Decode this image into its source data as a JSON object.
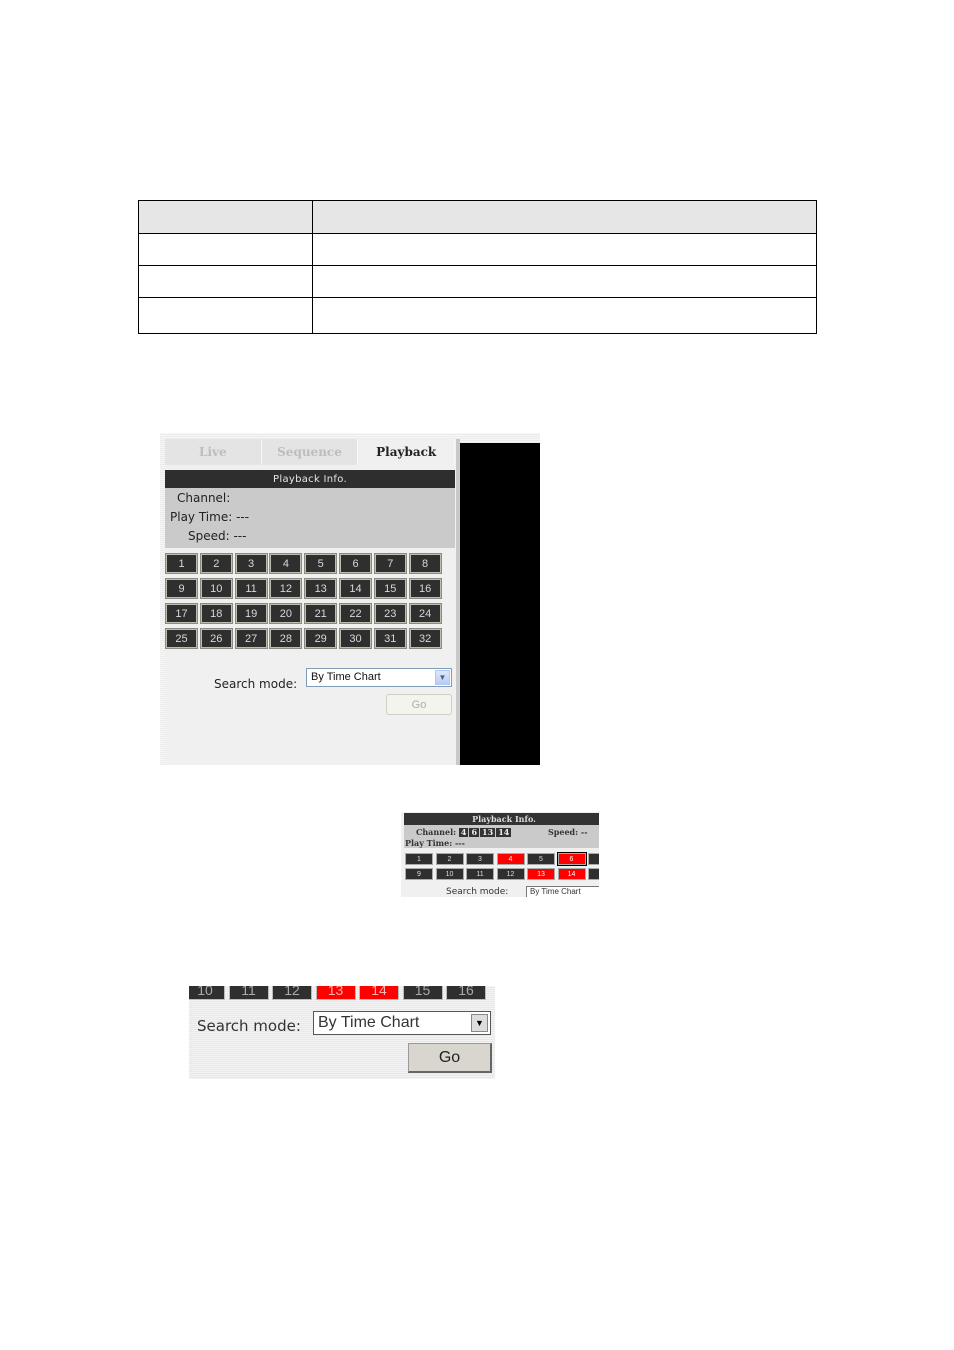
{
  "table": {
    "rows": [
      [
        "",
        ""
      ],
      [
        "",
        ""
      ],
      [
        "",
        ""
      ],
      [
        "",
        ""
      ]
    ]
  },
  "panel": {
    "tabs": [
      {
        "label": "Live",
        "active": false
      },
      {
        "label": "Sequence",
        "active": false
      },
      {
        "label": "Playback",
        "active": true
      }
    ],
    "info_title": "Playback Info.",
    "channel_label": "Channel:",
    "play_time_label": "Play Time: ---",
    "speed_label": "Speed: ---",
    "channels": [
      "1",
      "2",
      "3",
      "4",
      "5",
      "6",
      "7",
      "8",
      "9",
      "10",
      "11",
      "12",
      "13",
      "14",
      "15",
      "16",
      "17",
      "18",
      "19",
      "20",
      "21",
      "22",
      "23",
      "24",
      "25",
      "26",
      "27",
      "28",
      "29",
      "30",
      "31",
      "32"
    ],
    "search_mode_label": "Search mode:",
    "search_mode_value": "By Time Chart",
    "go_label": "Go"
  },
  "example_selected": {
    "info_title": "Playback Info.",
    "channel_label": "Channel:",
    "selected_channels": [
      "4",
      "6",
      "13",
      "14"
    ],
    "speed_label": "Speed: --",
    "play_time_label": "Play Time: ---",
    "row1": [
      "1",
      "2",
      "3",
      "4",
      "5",
      "6"
    ],
    "row2": [
      "9",
      "10",
      "11",
      "12",
      "13",
      "14"
    ],
    "red_channels": [
      "4",
      "6",
      "13",
      "14"
    ],
    "search_mode_label": "Search mode:",
    "search_mode_value": "By Time Chart",
    "highlight_color": "#ff0000"
  },
  "example_go": {
    "channels": [
      "10",
      "11",
      "12",
      "13",
      "14",
      "15",
      "16"
    ],
    "red_channels": [
      "13",
      "14"
    ],
    "search_mode_label": "Search mode:",
    "search_mode_value": "By Time Chart",
    "go_label": "Go"
  }
}
